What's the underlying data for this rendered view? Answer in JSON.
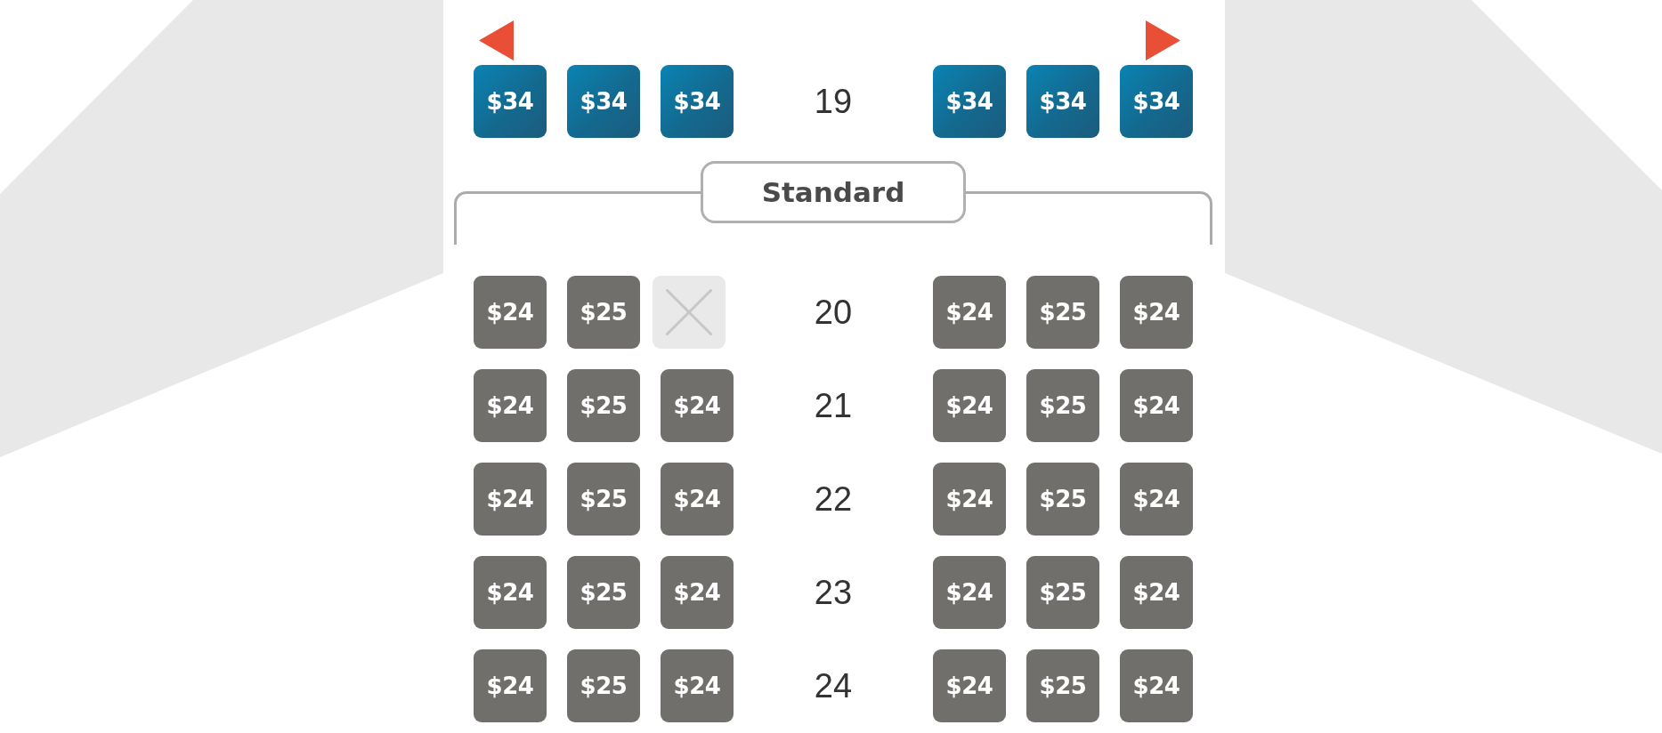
{
  "sections": [
    {
      "rows": [
        {
          "number": "19",
          "exit_row": true,
          "left_seats": [
            {
              "kind": "premium",
              "price": "$34"
            },
            {
              "kind": "premium",
              "price": "$34"
            },
            {
              "kind": "premium",
              "price": "$34"
            }
          ],
          "right_seats": [
            {
              "kind": "premium",
              "price": "$34"
            },
            {
              "kind": "premium",
              "price": "$34"
            },
            {
              "kind": "premium",
              "price": "$34"
            }
          ]
        }
      ]
    },
    {
      "label": "Standard",
      "rows": [
        {
          "number": "20",
          "exit_row": false,
          "left_seats": [
            {
              "kind": "standard",
              "price": "$24"
            },
            {
              "kind": "standard",
              "price": "$25"
            },
            {
              "kind": "unavailable"
            }
          ],
          "right_seats": [
            {
              "kind": "standard",
              "price": "$24"
            },
            {
              "kind": "standard",
              "price": "$25"
            },
            {
              "kind": "standard",
              "price": "$24"
            }
          ]
        },
        {
          "number": "21",
          "exit_row": false,
          "left_seats": [
            {
              "kind": "standard",
              "price": "$24"
            },
            {
              "kind": "standard",
              "price": "$25"
            },
            {
              "kind": "standard",
              "price": "$24"
            }
          ],
          "right_seats": [
            {
              "kind": "standard",
              "price": "$24"
            },
            {
              "kind": "standard",
              "price": "$25"
            },
            {
              "kind": "standard",
              "price": "$24"
            }
          ]
        },
        {
          "number": "22",
          "exit_row": false,
          "left_seats": [
            {
              "kind": "standard",
              "price": "$24"
            },
            {
              "kind": "standard",
              "price": "$25"
            },
            {
              "kind": "standard",
              "price": "$24"
            }
          ],
          "right_seats": [
            {
              "kind": "standard",
              "price": "$24"
            },
            {
              "kind": "standard",
              "price": "$25"
            },
            {
              "kind": "standard",
              "price": "$24"
            }
          ]
        },
        {
          "number": "23",
          "exit_row": false,
          "left_seats": [
            {
              "kind": "standard",
              "price": "$24"
            },
            {
              "kind": "standard",
              "price": "$25"
            },
            {
              "kind": "standard",
              "price": "$24"
            }
          ],
          "right_seats": [
            {
              "kind": "standard",
              "price": "$24"
            },
            {
              "kind": "standard",
              "price": "$25"
            },
            {
              "kind": "standard",
              "price": "$24"
            }
          ]
        },
        {
          "number": "24",
          "exit_row": false,
          "left_seats": [
            {
              "kind": "standard",
              "price": "$24"
            },
            {
              "kind": "standard",
              "price": "$25"
            },
            {
              "kind": "standard",
              "price": "$24"
            }
          ],
          "right_seats": [
            {
              "kind": "standard",
              "price": "$24"
            },
            {
              "kind": "standard",
              "price": "$25"
            },
            {
              "kind": "standard",
              "price": "$24"
            }
          ]
        }
      ]
    }
  ]
}
